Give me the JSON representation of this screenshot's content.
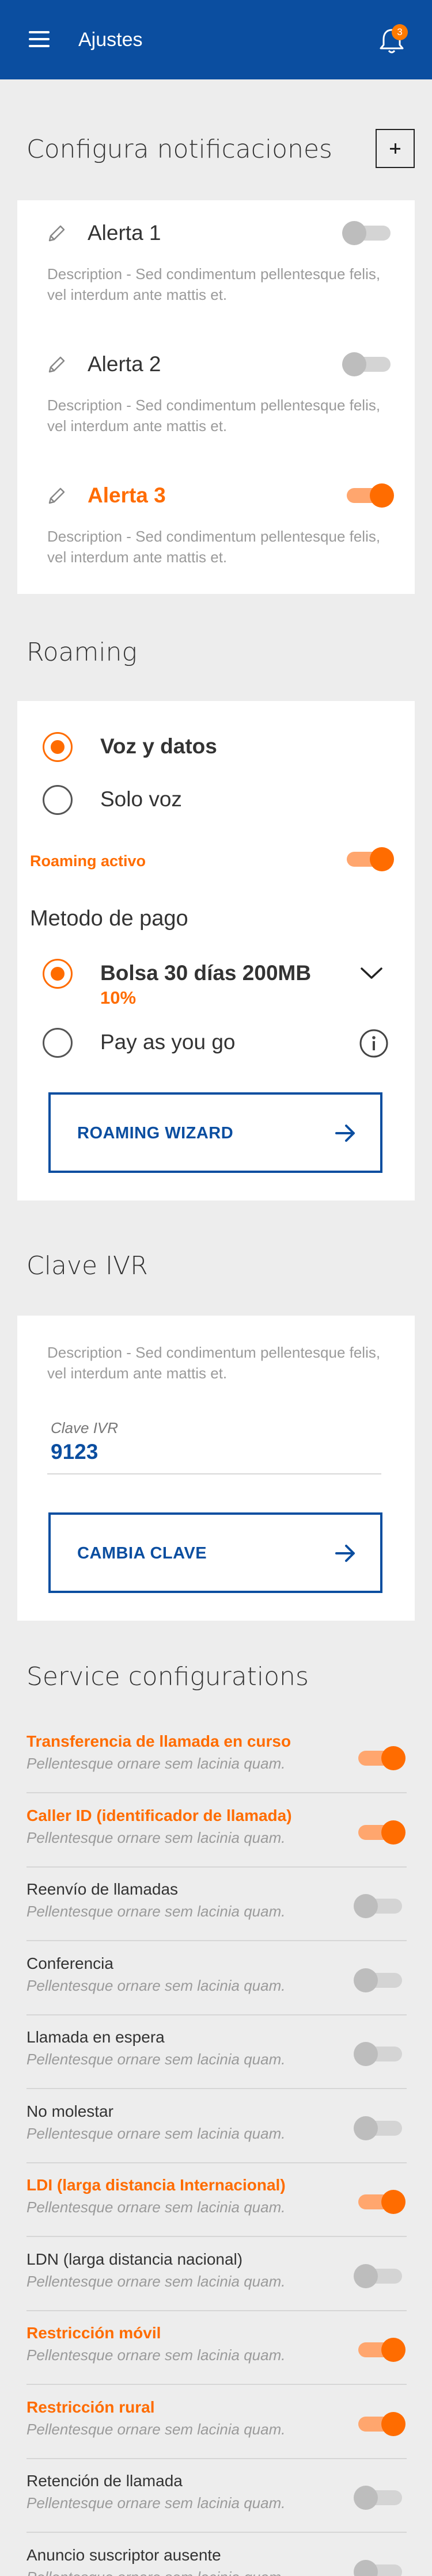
{
  "appbar": {
    "title": "Ajustes",
    "notification_count": "3",
    "color": "#0b4ea0"
  },
  "accent_color": "#ff6c00",
  "notifications": {
    "title": "Configura notificaciones",
    "alerts": [
      {
        "label": "Alerta 1",
        "description": "Description - Sed condimentum pellentesque felis, vel interdum ante mattis et.",
        "enabled": false
      },
      {
        "label": "Alerta 2",
        "description": "Description - Sed condimentum pellentesque felis, vel interdum ante mattis et.",
        "enabled": false
      },
      {
        "label": "Alerta 3",
        "description": "Description - Sed condimentum pellentesque felis, vel interdum ante mattis et.",
        "enabled": true
      }
    ]
  },
  "roaming": {
    "title": "Roaming",
    "options": [
      {
        "label": "Voz y datos",
        "selected": true
      },
      {
        "label": "Solo voz",
        "selected": false
      }
    ],
    "active_label": "Roaming activo",
    "active_enabled": true,
    "payment_title": "Metodo de pago",
    "payment_options": [
      {
        "label": "Bolsa 30 días 200MB",
        "sub": "10%",
        "selected": true,
        "icon": "chevron-down-icon"
      },
      {
        "label": "Pay as you go",
        "selected": false,
        "icon": "info-icon"
      }
    ],
    "wizard_label": "ROAMING WIZARD"
  },
  "ivr": {
    "title": "Clave IVR",
    "description": "Description - Sed condimentum pellentesque felis, vel interdum ante mattis et.",
    "field_label": "Clave IVR",
    "field_value": "9123",
    "button_label": "CAMBIA CLAVE"
  },
  "services": {
    "title": "Service configurations",
    "items": [
      {
        "label": "Transferencia de llamada en curso",
        "description": "Pellentesque ornare sem lacinia quam.",
        "enabled": true
      },
      {
        "label": "Caller ID (identificador de llamada)",
        "description": "Pellentesque ornare sem lacinia quam.",
        "enabled": true
      },
      {
        "label": "Reenvío de llamadas",
        "description": "Pellentesque ornare sem lacinia quam.",
        "enabled": false
      },
      {
        "label": "Conferencia",
        "description": "Pellentesque ornare sem lacinia quam.",
        "enabled": false
      },
      {
        "label": "Llamada en espera",
        "description": "Pellentesque ornare sem lacinia quam.",
        "enabled": false
      },
      {
        "label": "No molestar",
        "description": "Pellentesque ornare sem lacinia quam.",
        "enabled": false
      },
      {
        "label": "LDI (larga distancia Internacional)",
        "description": "Pellentesque ornare sem lacinia quam.",
        "enabled": true
      },
      {
        "label": "LDN (larga distancia nacional)",
        "description": "Pellentesque ornare sem lacinia quam.",
        "enabled": false
      },
      {
        "label": "Restricción móvil",
        "description": "Pellentesque ornare sem lacinia quam.",
        "enabled": true
      },
      {
        "label": "Restricción rural",
        "description": "Pellentesque ornare sem lacinia quam.",
        "enabled": true
      },
      {
        "label": "Retención de llamada",
        "description": "Pellentesque ornare sem lacinia quam.",
        "enabled": false
      },
      {
        "label": "Anuncio suscriptor ausente",
        "description": "Pellentesque ornare sem lacinia quam.",
        "enabled": false
      }
    ]
  }
}
